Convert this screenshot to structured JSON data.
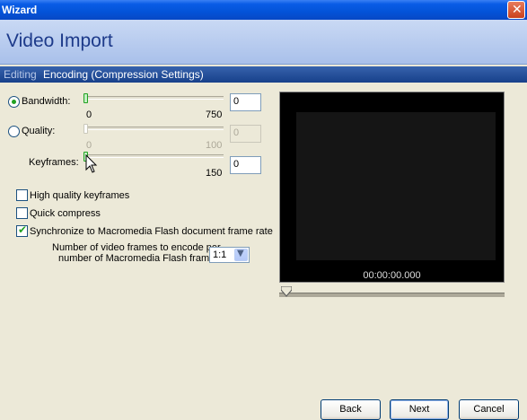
{
  "window": {
    "title": "Wizard",
    "close_glyph": "✕"
  },
  "header": {
    "title": "Video Import"
  },
  "breadcrumb": {
    "previous": "Editing",
    "current": "Encoding (Compression Settings)"
  },
  "bandwidth": {
    "label": "Bandwidth:",
    "selected": true,
    "min_label": "0",
    "max_label": "750",
    "value": "0",
    "position": 0.0
  },
  "quality": {
    "label": "Quality:",
    "selected": false,
    "enabled": false,
    "min_label": "0",
    "max_label": "100",
    "value": "0",
    "position": 0.0
  },
  "keyframes": {
    "label": "Keyframes:",
    "max_label": "150",
    "value": "0",
    "position": 0.0
  },
  "options": {
    "high_quality_keyframes": {
      "label": "High quality keyframes",
      "checked": false
    },
    "quick_compress": {
      "label": "Quick compress",
      "checked": false
    },
    "synchronize": {
      "label": "Synchronize to Macromedia Flash document frame rate",
      "checked": true
    }
  },
  "frame_ratio": {
    "label_line1": "Number of video frames to encode per",
    "label_line2": "number of Macromedia Flash frames",
    "value": "1:1"
  },
  "preview": {
    "timecode": "00:00:00.000",
    "playhead": 0.0
  },
  "buttons": {
    "back": "Back",
    "next": "Next",
    "cancel": "Cancel"
  },
  "colors": {
    "accent_green": "#21a121",
    "title_blue": "#0353d8",
    "header_text": "#1d3a8a"
  }
}
